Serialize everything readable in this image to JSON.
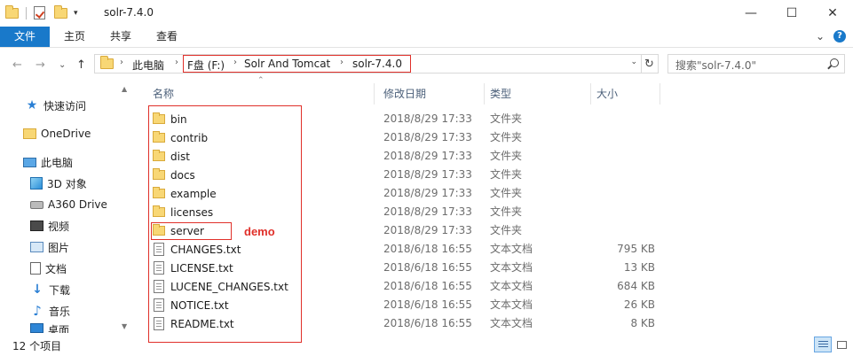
{
  "window": {
    "title": "solr-7.4.0",
    "minimize": "—",
    "maximize": "☐",
    "close": "✕"
  },
  "ribbon": {
    "tabs": [
      "文件",
      "主页",
      "共享",
      "查看"
    ],
    "expand": "⌄",
    "help": "?"
  },
  "address": {
    "back": "←",
    "forward": "→",
    "recent": "⌄",
    "up": "↑",
    "crumbs": [
      "此电脑",
      "F盘 (F:)",
      "Solr And Tomcat",
      "solr-7.4.0"
    ],
    "refresh": "↻",
    "search_placeholder": "搜索\"solr-7.4.0\""
  },
  "nav": {
    "items": [
      {
        "label": "快速访问",
        "icon": "star-icon"
      },
      {
        "label": "OneDrive",
        "icon": "folder-icon"
      },
      {
        "label": "此电脑",
        "icon": "computer-icon"
      },
      {
        "label": "3D 对象",
        "icon": "3d-objects-icon"
      },
      {
        "label": "A360 Drive",
        "icon": "drive-icon"
      },
      {
        "label": "视频",
        "icon": "video-icon"
      },
      {
        "label": "图片",
        "icon": "pictures-icon"
      },
      {
        "label": "文档",
        "icon": "documents-icon"
      },
      {
        "label": "下载",
        "icon": "download-icon"
      },
      {
        "label": "音乐",
        "icon": "music-icon"
      },
      {
        "label": "桌面",
        "icon": "desktop-icon"
      }
    ]
  },
  "columns": {
    "name": "名称",
    "date": "修改日期",
    "type": "类型",
    "size": "大小"
  },
  "files": [
    {
      "name": "bin",
      "date": "2018/8/29 17:33",
      "type": "文件夹",
      "size": "",
      "kind": "folder"
    },
    {
      "name": "contrib",
      "date": "2018/8/29 17:33",
      "type": "文件夹",
      "size": "",
      "kind": "folder"
    },
    {
      "name": "dist",
      "date": "2018/8/29 17:33",
      "type": "文件夹",
      "size": "",
      "kind": "folder"
    },
    {
      "name": "docs",
      "date": "2018/8/29 17:33",
      "type": "文件夹",
      "size": "",
      "kind": "folder"
    },
    {
      "name": "example",
      "date": "2018/8/29 17:33",
      "type": "文件夹",
      "size": "",
      "kind": "folder"
    },
    {
      "name": "licenses",
      "date": "2018/8/29 17:33",
      "type": "文件夹",
      "size": "",
      "kind": "folder"
    },
    {
      "name": "server",
      "date": "2018/8/29 17:33",
      "type": "文件夹",
      "size": "",
      "kind": "folder"
    },
    {
      "name": "CHANGES.txt",
      "date": "2018/6/18 16:55",
      "type": "文本文档",
      "size": "795 KB",
      "kind": "text"
    },
    {
      "name": "LICENSE.txt",
      "date": "2018/6/18 16:55",
      "type": "文本文档",
      "size": "13 KB",
      "kind": "text"
    },
    {
      "name": "LUCENE_CHANGES.txt",
      "date": "2018/6/18 16:55",
      "type": "文本文档",
      "size": "684 KB",
      "kind": "text"
    },
    {
      "name": "NOTICE.txt",
      "date": "2018/6/18 16:55",
      "type": "文本文档",
      "size": "26 KB",
      "kind": "text"
    },
    {
      "name": "README.txt",
      "date": "2018/6/18 16:55",
      "type": "文本文档",
      "size": "8 KB",
      "kind": "text"
    }
  ],
  "annotation": {
    "demo_label": "demo",
    "color": "#e0302a"
  },
  "status": {
    "item_count": "12 个项目"
  },
  "colors": {
    "accent": "#1979ca",
    "folder": "#f8d775"
  }
}
